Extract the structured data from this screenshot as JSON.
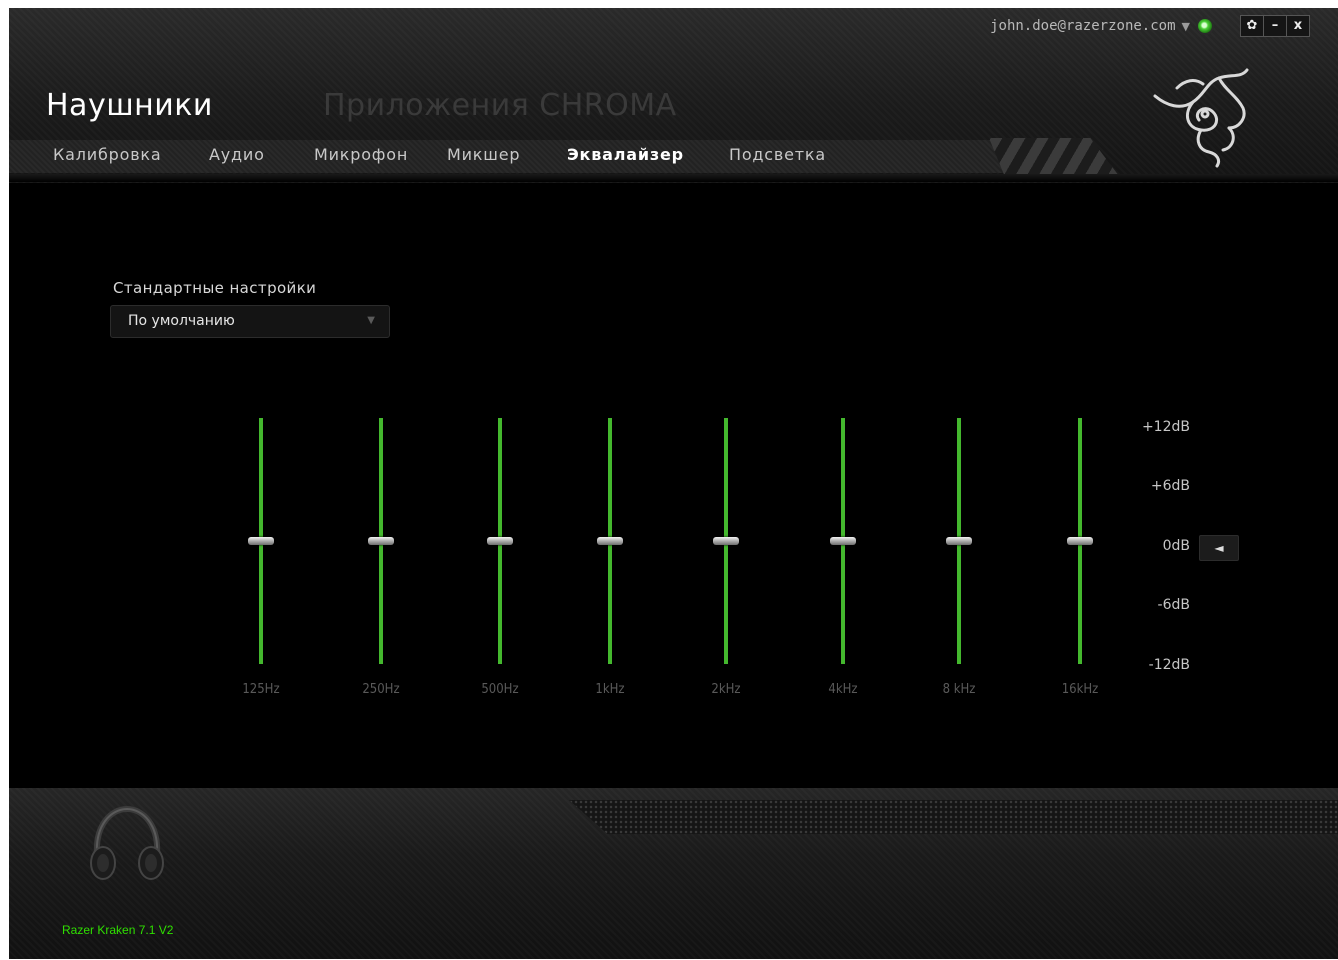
{
  "app": {
    "title": "Наушники",
    "chroma_title": "Приложения CHROMA",
    "account": "john.doe@razerzone.com",
    "window_controls": {
      "settings": "✿",
      "minimize": "–",
      "close": "x"
    }
  },
  "tabs": [
    {
      "label": "Калибровка",
      "active": false
    },
    {
      "label": "Аудио",
      "active": false
    },
    {
      "label": "Микрофон",
      "active": false
    },
    {
      "label": "Микшер",
      "active": false
    },
    {
      "label": "Эквалайзер",
      "active": true
    },
    {
      "label": "Подсветка",
      "active": false
    }
  ],
  "preset": {
    "label": "Стандартные настройки",
    "value": "По умолчанию"
  },
  "equalizer": {
    "bands": [
      {
        "label": "125Hz",
        "gain_db": 0
      },
      {
        "label": "250Hz",
        "gain_db": 0
      },
      {
        "label": "500Hz",
        "gain_db": 0
      },
      {
        "label": "1kHz",
        "gain_db": 0
      },
      {
        "label": "2kHz",
        "gain_db": 0
      },
      {
        "label": "4kHz",
        "gain_db": 0
      },
      {
        "label": "8 kHz",
        "gain_db": 0
      },
      {
        "label": "16kHz",
        "gain_db": 0
      }
    ],
    "scale": [
      "+12dB",
      "+6dB",
      "0dB",
      "-6dB",
      "-12dB"
    ],
    "range_db": [
      -12,
      12
    ],
    "reset_symbol": "◄"
  },
  "device": {
    "name": "Razer Kraken 7.1 V2"
  },
  "colors": {
    "accent": "#44b82e",
    "device_name": "#2fe000"
  }
}
